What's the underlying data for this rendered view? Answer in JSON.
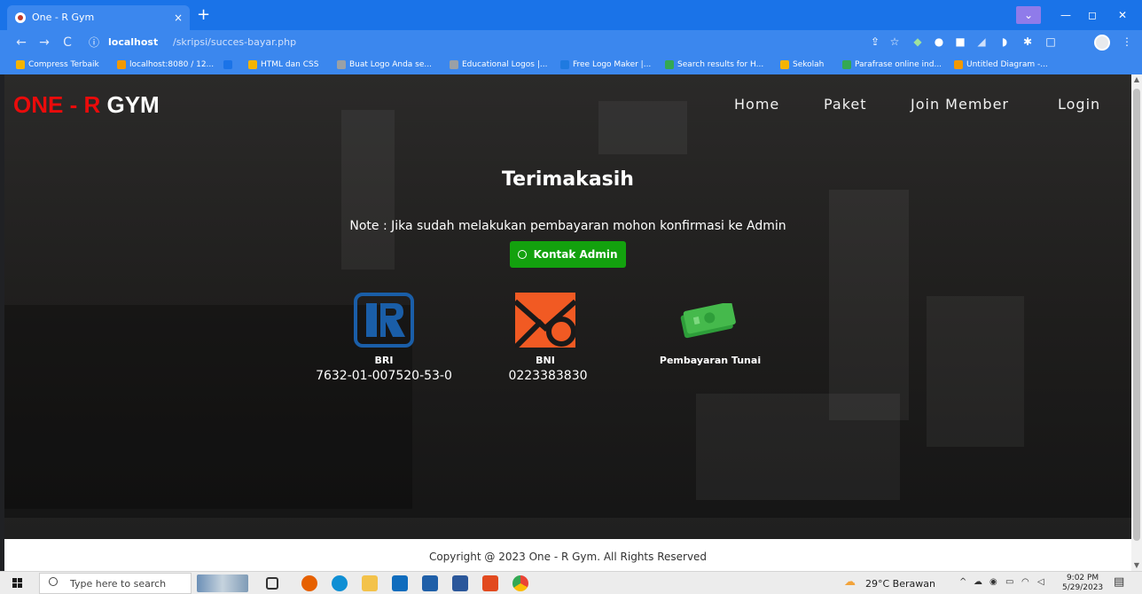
{
  "browser": {
    "tab_title": "One - R Gym",
    "tab_close": "×",
    "new_tab": "+",
    "window_controls": {
      "dropdown": "⌄",
      "minimize": "—",
      "maximize": "◻",
      "close": "✕"
    },
    "nav": {
      "back": "←",
      "forward": "→",
      "reload": "C"
    },
    "url": {
      "info_icon": "ⓘ",
      "host": "localhost",
      "path": "/skripsi/succes-bayar.php"
    },
    "toolbar_icons": [
      "share-icon",
      "star-icon",
      "extension-icon",
      "extension-icon",
      "extension-icon",
      "extension-icon",
      "extension-icon",
      "puzzle-icon",
      "sidebar-icon",
      "profile-icon",
      "menu-icon"
    ]
  },
  "bookmarks": [
    {
      "label": "Compress Terbaik",
      "color": "#f4b400"
    },
    {
      "label": "localhost:8080 / 12...",
      "color": "#f29900"
    },
    {
      "label": "",
      "color": "#1a73e8"
    },
    {
      "label": "HTML dan CSS",
      "color": "#f4b400"
    },
    {
      "label": "Buat Logo Anda se...",
      "color": "#9aa0a6"
    },
    {
      "label": "Educational Logos |...",
      "color": "#9aa0a6"
    },
    {
      "label": "Free Logo Maker |...",
      "color": "#1f7ae0"
    },
    {
      "label": "Search results for H...",
      "color": "#34a853"
    },
    {
      "label": "Sekolah",
      "color": "#f4b400"
    },
    {
      "label": "Parafrase online ind...",
      "color": "#34a853"
    },
    {
      "label": "Untitled Diagram -...",
      "color": "#f29900"
    }
  ],
  "site": {
    "brand_red": "ONE - R",
    "brand_white": "GYM",
    "nav": [
      "Home",
      "Paket",
      "Join Member",
      "Login"
    ],
    "heading": "Terimakasih",
    "note": "Note : Jika sudah melakukan pembayaran mohon konfirmasi ke Admin",
    "contact_button": "Kontak Admin",
    "payments": [
      {
        "label": "BRI",
        "number": "7632-01-007520-53-0",
        "color": "#1a5ea8"
      },
      {
        "label": "BNI",
        "number": "0223383830",
        "color": "#f15a23"
      },
      {
        "label": "Pembayaran Tunai",
        "number": "",
        "color": "#2e9e3a"
      }
    ],
    "footer": "Copyright @ 2023 One - R Gym. All Rights Reserved"
  },
  "taskbar": {
    "search_placeholder": "Type here to search",
    "weather": "29°C  Berawan",
    "time": "9:02 PM",
    "date": "5/29/2023",
    "apps": [
      "task-view-icon",
      "firefox-icon",
      "edge-icon",
      "file-explorer-icon",
      "mail-icon",
      "photos-icon",
      "word-icon",
      "office-icon",
      "chrome-icon"
    ]
  }
}
